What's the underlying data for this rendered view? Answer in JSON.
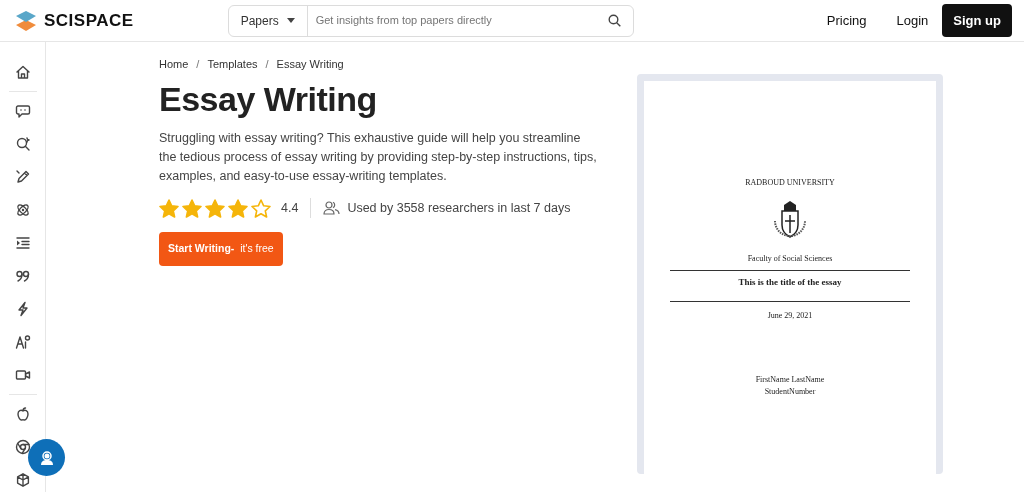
{
  "header": {
    "logo_text": "SCISPACE",
    "search": {
      "scope": "Papers",
      "placeholder": "Get insights from top papers directly"
    },
    "nav": [
      {
        "label": "Pricing",
        "kind": "link"
      },
      {
        "label": "Login",
        "kind": "link"
      },
      {
        "label": "Sign up",
        "kind": "primary"
      }
    ]
  },
  "breadcrumb": [
    {
      "kind": "link",
      "label": "Home"
    },
    {
      "kind": "separator",
      "label": "/"
    },
    {
      "kind": "link",
      "label": "Templates"
    },
    {
      "kind": "separator",
      "label": "/"
    },
    {
      "kind": "link",
      "label": "Essay Writing"
    }
  ],
  "title": "Essay Writing",
  "description": "Struggling with essay writing? This exhaustive guide will help you streamline the tedious process of essay writing by providing step-by-step instructions, tips, examples, and easy-to-use essay-writing templates.",
  "rating": {
    "stars": 4,
    "value": "4.4"
  },
  "usage": "Used by 3558 researchers in last 7 days",
  "cta": "**Start Writing-**  it's free",
  "preview": {
    "university": "RADBOUD UNIVERSITY",
    "faculty": "Faculty of Social Sciences",
    "essay_title": "This is the title of the essay",
    "date": "June 29, 2021",
    "author": "FirstName LastName",
    "student_number": "StudentNumber"
  }
}
